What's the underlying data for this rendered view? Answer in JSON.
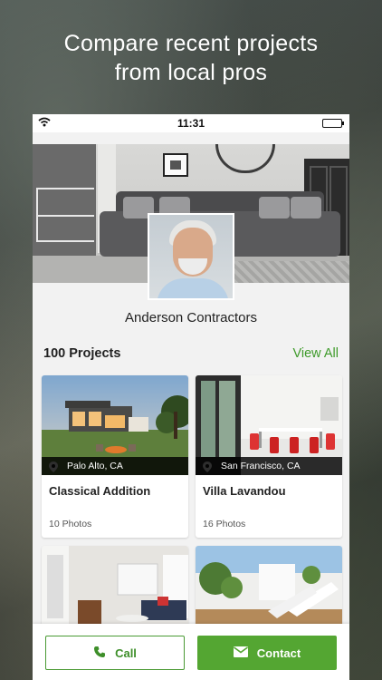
{
  "headline": {
    "line1": "Compare recent projects",
    "line2": "from local pros"
  },
  "status_bar": {
    "time": "11:31"
  },
  "profile": {
    "company_name": "Anderson Contractors"
  },
  "projects": {
    "count_label": "100 Projects",
    "view_all_label": "View All",
    "items": [
      {
        "location": "Palo Alto, CA",
        "title": "Classical Addition",
        "photos": "10 Photos"
      },
      {
        "location": "San Francisco, CA",
        "title": "Villa Lavandou",
        "photos": "16 Photos"
      },
      {
        "location": "",
        "title": "",
        "photos": ""
      },
      {
        "location": "",
        "title": "",
        "photos": ""
      }
    ]
  },
  "actions": {
    "call_label": "Call",
    "contact_label": "Contact"
  },
  "colors": {
    "accent_green": "#54a632",
    "link_green": "#3e9a2a"
  },
  "icons": {
    "wifi": "wifi-icon",
    "battery": "battery-icon",
    "pin": "location-pin-icon",
    "phone": "phone-icon",
    "mail": "mail-icon"
  }
}
